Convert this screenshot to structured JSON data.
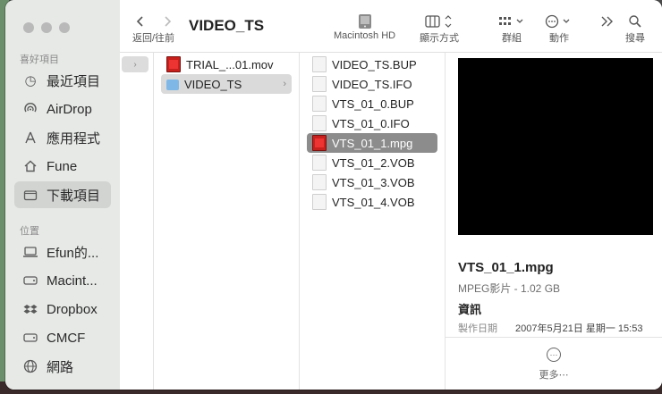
{
  "toolbar": {
    "back_forward_label": "返回/往前",
    "title": "VIDEO_TS",
    "disk_label": "Macintosh HD",
    "view_label": "顯示方式",
    "group_label": "群組",
    "action_label": "動作",
    "search_label": "搜尋"
  },
  "sidebar": {
    "favorites_title": "喜好項目",
    "favorites": [
      {
        "label": "最近項目",
        "icon": "clock-icon"
      },
      {
        "label": "AirDrop",
        "icon": "airdrop-icon"
      },
      {
        "label": "應用程式",
        "icon": "apps-icon"
      },
      {
        "label": "Fune",
        "icon": "home-icon"
      },
      {
        "label": "下載項目",
        "icon": "downloads-icon",
        "selected": true
      }
    ],
    "locations_title": "位置",
    "locations": [
      {
        "label": "Efun的...",
        "icon": "laptop-icon"
      },
      {
        "label": "Macint...",
        "icon": "disk-icon"
      },
      {
        "label": "Dropbox",
        "icon": "dropbox-icon"
      },
      {
        "label": "CMCF",
        "icon": "disk-icon"
      },
      {
        "label": "網路",
        "icon": "globe-icon"
      }
    ]
  },
  "column2": {
    "items": [
      {
        "label": "TRIAL_...01.mov",
        "icon": "film-icon"
      },
      {
        "label": "VIDEO_TS",
        "icon": "folder-icon",
        "selected": true
      }
    ]
  },
  "column3": {
    "items": [
      {
        "label": "VIDEO_TS.BUP",
        "icon": "document-icon"
      },
      {
        "label": "VIDEO_TS.IFO",
        "icon": "document-icon"
      },
      {
        "label": "VTS_01_0.BUP",
        "icon": "document-icon"
      },
      {
        "label": "VTS_01_0.IFO",
        "icon": "document-icon"
      },
      {
        "label": "VTS_01_1.mpg",
        "icon": "film-icon",
        "selected": true
      },
      {
        "label": "VTS_01_2.VOB",
        "icon": "document-icon"
      },
      {
        "label": "VTS_01_3.VOB",
        "icon": "document-icon"
      },
      {
        "label": "VTS_01_4.VOB",
        "icon": "document-icon"
      }
    ]
  },
  "preview": {
    "file_name": "VTS_01_1.mpg",
    "meta": "MPEG影片 - 1.02 GB",
    "info_title": "資訊",
    "date_label": "製作日期",
    "date_value": "2007年5月21日 星期一 15:53",
    "more_label": "更多⋯"
  }
}
